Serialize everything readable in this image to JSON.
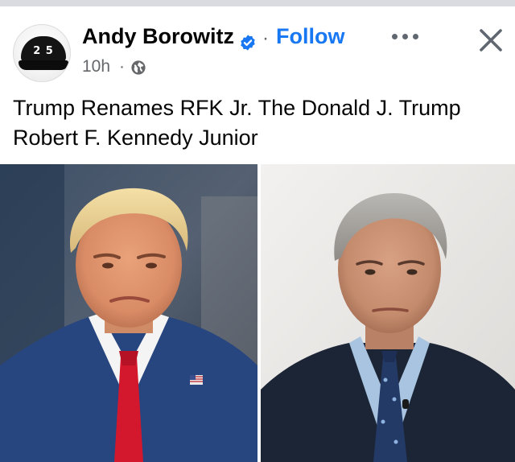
{
  "post": {
    "author": "Andy Borowitz",
    "separator": "·",
    "follow_label": "Follow",
    "timestamp": "10h",
    "meta_separator": "·",
    "audience_icon": "globe-icon",
    "text": "Trump Renames RFK Jr. The Donald J. Trump Robert F. Kennedy Junior"
  },
  "avatar": {
    "cap_text": "2 5",
    "icon": "cap-avatar"
  },
  "icons": {
    "verified": "verified-badge-icon",
    "more": "more-options-icon",
    "close": "close-icon"
  },
  "colors": {
    "link_blue": "#1877f2",
    "secondary_text": "#65676b",
    "primary_text": "#050505",
    "top_strip": "#d9dbe0"
  },
  "images": [
    {
      "name": "photo-left",
      "description_icon": "portrait-photo"
    },
    {
      "name": "photo-right",
      "description_icon": "portrait-photo"
    }
  ]
}
